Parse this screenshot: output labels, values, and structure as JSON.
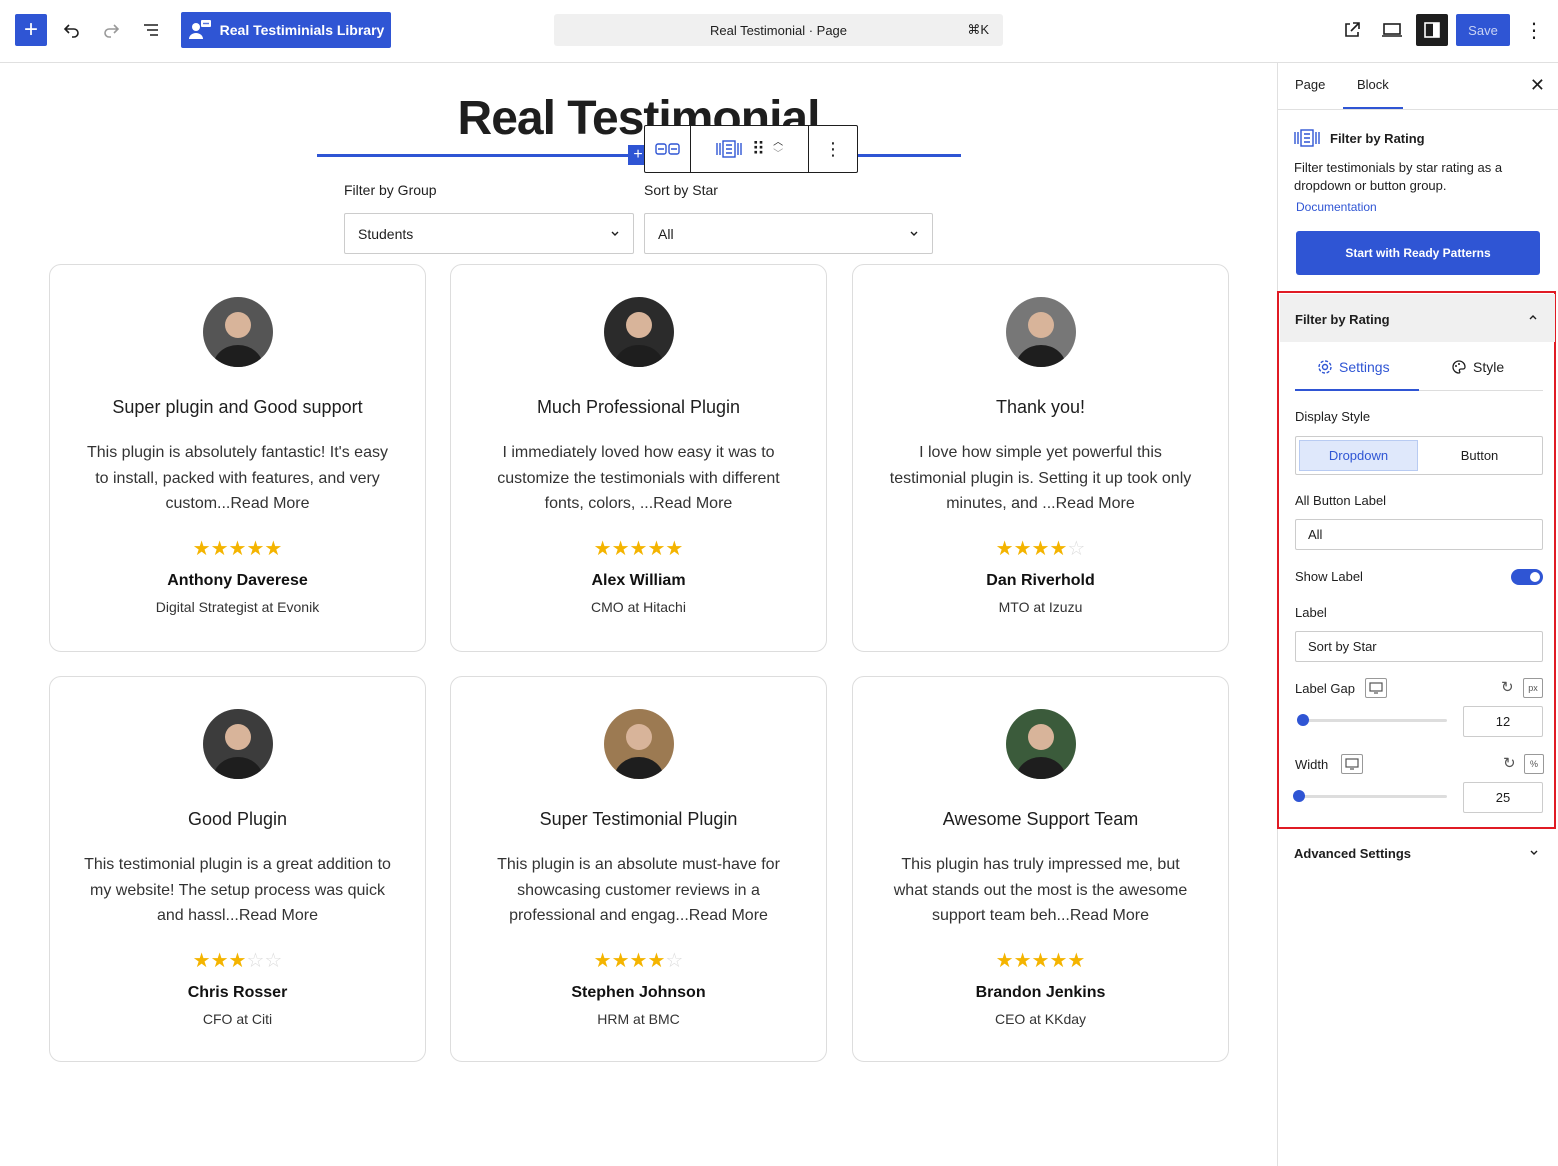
{
  "topbar": {
    "library_label": "Real Testiminials Library",
    "command_text": "Real Testimonial · Page",
    "command_shortcut": "⌘K",
    "save_label": "Save"
  },
  "canvas": {
    "page_title": "Real Testimonial",
    "filter_group_label": "Filter by Group",
    "filter_group_value": "Students",
    "sort_star_label": "Sort by Star",
    "sort_star_value": "All"
  },
  "testimonials": [
    {
      "title": "Super plugin and Good support",
      "text": "This plugin is absolutely fantastic! It's easy to install, packed with features, and very custom...Read More",
      "rating": 5,
      "name": "Anthony Daverese",
      "role": "Digital Strategist at Evonik"
    },
    {
      "title": "Much Professional Plugin",
      "text": "I immediately loved how easy it was to customize the testimonials with different fonts, colors, ...Read More",
      "rating": 5,
      "name": "Alex William",
      "role": "CMO at Hitachi"
    },
    {
      "title": "Thank you!",
      "text": "I love how simple yet powerful this testimonial plugin is. Setting it up took only minutes, and ...Read More",
      "rating": 4,
      "name": "Dan Riverhold",
      "role": "MTO at Izuzu"
    },
    {
      "title": "Good Plugin",
      "text": "This testimonial plugin is a great addition to my website! The setup process was quick and hassl...Read More",
      "rating": 3,
      "name": "Chris Rosser",
      "role": "CFO at Citi"
    },
    {
      "title": "Super Testimonial Plugin",
      "text": "This plugin is an absolute must-have for showcasing customer reviews in a professional and engag...Read More",
      "rating": 4,
      "name": "Stephen Johnson",
      "role": "HRM at BMC"
    },
    {
      "title": "Awesome Support Team",
      "text": "This plugin has truly impressed me, but what stands out the most is the awesome support team beh...Read More",
      "rating": 5,
      "name": "Brandon Jenkins",
      "role": "CEO at KKday"
    }
  ],
  "sidebar": {
    "tab_page": "Page",
    "tab_block": "Block",
    "block_title": "Filter by Rating",
    "block_desc": "Filter testimonials by star rating as a dropdown or button group.",
    "doc_link": "Documentation",
    "patterns_button": "Start with Ready Patterns",
    "panel_title": "Filter by Rating",
    "settings_tab": "Settings",
    "style_tab": "Style",
    "display_style_label": "Display Style",
    "display_dropdown": "Dropdown",
    "display_button": "Button",
    "all_button_label": "All Button Label",
    "all_button_value": "All",
    "show_label": "Show Label",
    "show_label_on": true,
    "label_label": "Label",
    "label_value": "Sort by Star",
    "label_gap_label": "Label Gap",
    "label_gap_unit": "px",
    "label_gap_value": "12",
    "label_gap_fraction": 0.03,
    "width_label": "Width",
    "width_unit": "%",
    "width_value": "25",
    "width_fraction": 0.0,
    "advanced_label": "Advanced Settings"
  },
  "colors": {
    "accent": "#2f55d4",
    "star": "#f4b400",
    "highlight": "#e01b24"
  }
}
